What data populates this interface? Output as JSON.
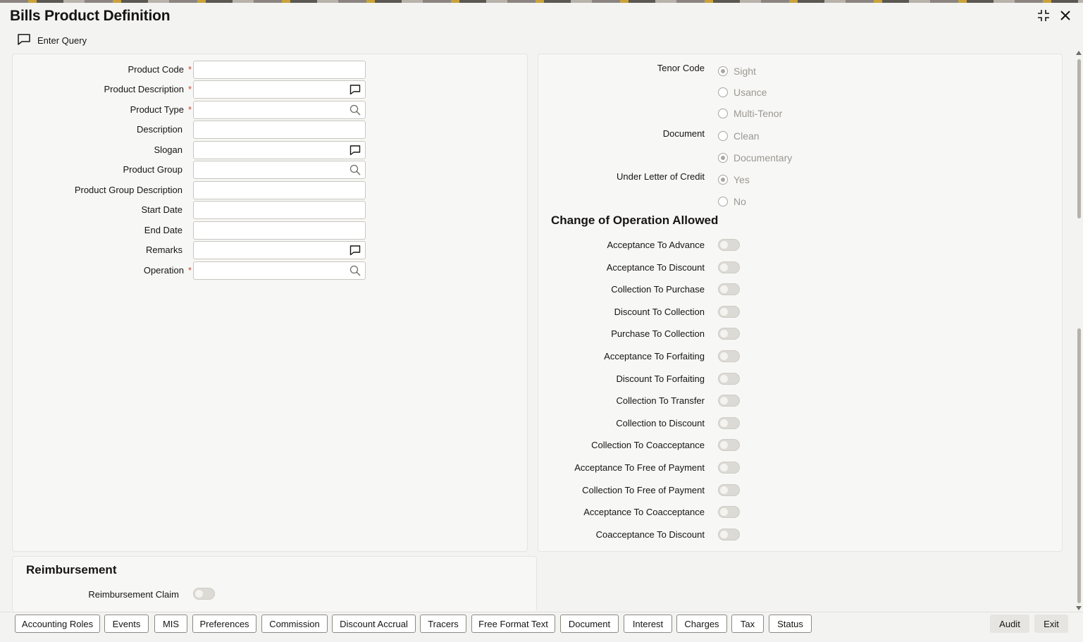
{
  "header": {
    "title": "Bills Product Definition"
  },
  "toolbar": {
    "enter_query": "Enter Query"
  },
  "left_fields": [
    {
      "label": "Product Code",
      "required": "*",
      "icon": ""
    },
    {
      "label": "Product Description",
      "required": "*",
      "icon": "comment-icon"
    },
    {
      "label": "Product Type",
      "required": "*",
      "icon": "search-icon"
    },
    {
      "label": "Description",
      "required": "",
      "icon": ""
    },
    {
      "label": "Slogan",
      "required": "",
      "icon": "comment-icon"
    },
    {
      "label": "Product Group",
      "required": "",
      "icon": "search-icon"
    },
    {
      "label": "Product Group Description",
      "required": "",
      "icon": ""
    },
    {
      "label": "Start Date",
      "required": "",
      "icon": ""
    },
    {
      "label": "End Date",
      "required": "",
      "icon": ""
    },
    {
      "label": "Remarks",
      "required": "",
      "icon": "comment-icon"
    },
    {
      "label": "Operation",
      "required": "*",
      "icon": "search-icon"
    }
  ],
  "tenor": {
    "label": "Tenor Code",
    "options": [
      "Sight",
      "Usance",
      "Multi-Tenor"
    ],
    "selected": "Sight"
  },
  "document": {
    "label": "Document",
    "options": [
      "Clean",
      "Documentary"
    ],
    "selected": "Documentary"
  },
  "ulc": {
    "label": "Under Letter of Credit",
    "options": [
      "Yes",
      "No"
    ],
    "selected": "Yes"
  },
  "change_ops": {
    "title": "Change of Operation Allowed",
    "items": [
      "Acceptance To Advance",
      "Acceptance To Discount",
      "Collection To Purchase",
      "Discount To Collection",
      "Purchase To Collection",
      "Acceptance To Forfaiting",
      "Discount To Forfaiting",
      "Collection To Transfer",
      "Collection to Discount",
      "Collection To Coacceptance",
      "Acceptance To Free of Payment",
      "Collection To Free of Payment",
      "Acceptance To Coacceptance",
      "Coacceptance To Discount"
    ]
  },
  "reimbursement": {
    "title": "Reimbursement",
    "claim_label": "Reimbursement Claim"
  },
  "footer": {
    "tabs": [
      "Accounting Roles",
      "Events",
      "MIS",
      "Preferences",
      "Commission",
      "Discount Accrual",
      "Tracers",
      "Free Format Text",
      "Document",
      "Interest",
      "Charges",
      "Tax",
      "Status"
    ],
    "audit": "Audit",
    "exit": "Exit"
  }
}
